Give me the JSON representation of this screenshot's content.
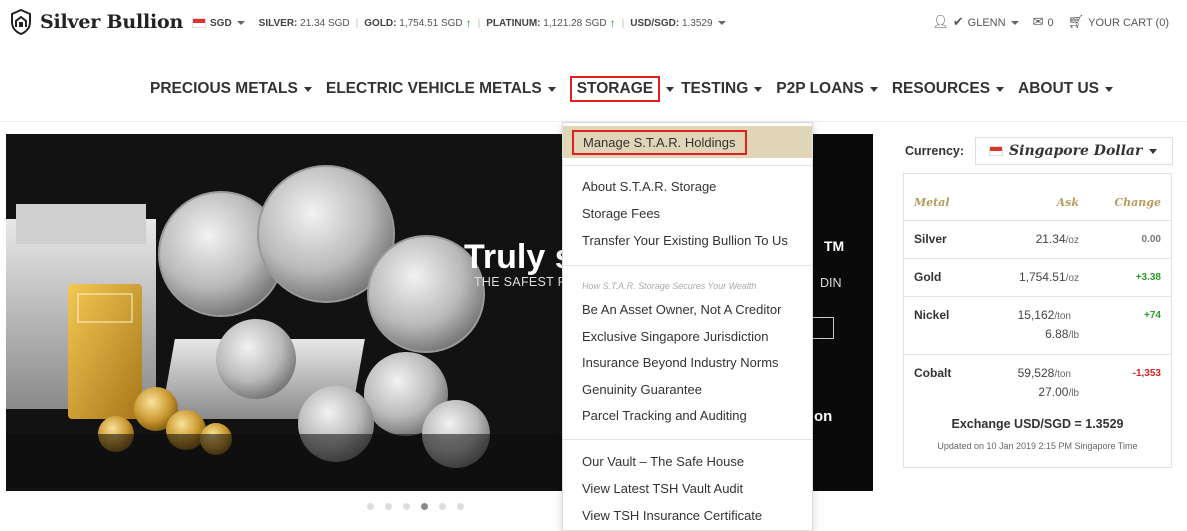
{
  "brand": {
    "name": "Silver Bullion"
  },
  "ticker": {
    "currency": "SGD",
    "silver_label": "SILVER:",
    "silver_value": "21.34 SGD",
    "gold_label": "GOLD:",
    "gold_value": "1,754.51 SGD",
    "platinum_label": "PLATINUM:",
    "platinum_value": "1,121.28 SGD",
    "fx_label": "USD/SGD:",
    "fx_value": "1.3529"
  },
  "userbar": {
    "user": "GLENN",
    "messages": "0",
    "cart": "YOUR CART (0)"
  },
  "nav": [
    {
      "label": "PRECIOUS METALS"
    },
    {
      "label": "ELECTRIC VEHICLE METALS"
    },
    {
      "label": "STORAGE"
    },
    {
      "label": "TESTING"
    },
    {
      "label": "P2P LOANS"
    },
    {
      "label": "RESOURCES"
    },
    {
      "label": "ABOUT US"
    }
  ],
  "hero": {
    "headline": "Truly s",
    "tm": "TM",
    "subtitle": "THE SAFEST P",
    "subtitle_end": "DIN",
    "bottom": "on",
    "slides": 6,
    "active_slide": 4
  },
  "dropdown": {
    "highlighted": "Manage S.T.A.R. Holdings",
    "group1": [
      "About S.T.A.R. Storage",
      "Storage Fees",
      "Transfer Your Existing Bullion To Us"
    ],
    "section_title": "How S.T.A.R. Storage Secures Your Wealth",
    "group2": [
      "Be An Asset Owner, Not A Creditor",
      "Exclusive Singapore Jurisdiction",
      "Insurance Beyond Industry Norms",
      "Genuinity Guarantee",
      "Parcel Tracking and Auditing"
    ],
    "group3": [
      "Our Vault – The Safe House",
      "View Latest TSH Vault Audit",
      "View TSH Insurance Certificate"
    ]
  },
  "currency": {
    "label": "Currency:",
    "value": "Singapore Dollar"
  },
  "prices": {
    "headers": {
      "metal": "Metal",
      "ask": "Ask",
      "change": "Change"
    },
    "rows": [
      {
        "metal": "Silver",
        "ask": "21.34",
        "unit": "/oz",
        "change": "0.00",
        "change_color": "#777777"
      },
      {
        "metal": "Gold",
        "ask": "1,754.51",
        "unit": "/oz",
        "change": "+3.38",
        "change_color": "#2a9a2a"
      },
      {
        "metal": "Nickel",
        "ask": "15,162",
        "unit": "/ton",
        "ask2": "6.88",
        "unit2": "/lb",
        "change": "+74",
        "change_color": "#2a9a2a"
      },
      {
        "metal": "Cobalt",
        "ask": "59,528",
        "unit": "/ton",
        "ask2": "27.00",
        "unit2": "/lb",
        "change": "-1,353",
        "change_color": "#d32020"
      }
    ],
    "exchange": "Exchange USD/SGD = 1.3529",
    "updated": "Updated on 10 Jan 2019 2:15 PM Singapore Time"
  }
}
